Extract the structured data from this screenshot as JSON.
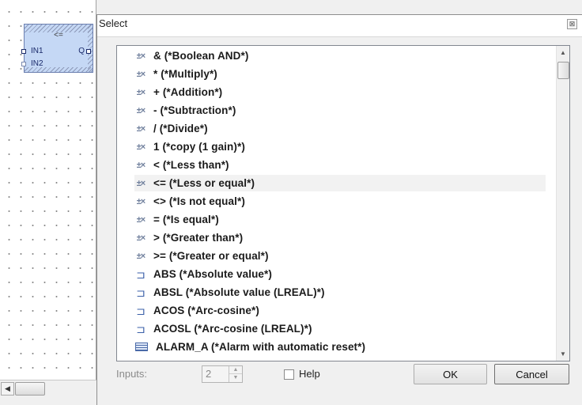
{
  "canvas": {
    "block": {
      "name": "<=",
      "input1": "IN1",
      "input2": "IN2",
      "output": "Q"
    }
  },
  "dialog": {
    "title": "Select",
    "items": [
      {
        "icon": "operator-icon",
        "label": "& (*Boolean AND*)"
      },
      {
        "icon": "operator-icon",
        "label": "* (*Multiply*)"
      },
      {
        "icon": "operator-icon",
        "label": "+ (*Addition*)"
      },
      {
        "icon": "operator-icon",
        "label": "- (*Subtraction*)"
      },
      {
        "icon": "operator-icon",
        "label": "/ (*Divide*)"
      },
      {
        "icon": "operator-icon",
        "label": "1 (*copy (1 gain)*)"
      },
      {
        "icon": "operator-icon",
        "label": "< (*Less than*)"
      },
      {
        "icon": "operator-icon",
        "label": "<= (*Less or equal*)",
        "highlighted": true
      },
      {
        "icon": "operator-icon",
        "label": "<> (*Is not equal*)"
      },
      {
        "icon": "operator-icon",
        "label": "= (*Is equal*)"
      },
      {
        "icon": "operator-icon",
        "label": "> (*Greater than*)"
      },
      {
        "icon": "operator-icon",
        "label": ">= (*Greater or equal*)"
      },
      {
        "icon": "function-icon",
        "label": "ABS (*Absolute value*)"
      },
      {
        "icon": "function-icon",
        "label": "ABSL (*Absolute value (LREAL)*)"
      },
      {
        "icon": "function-icon",
        "label": "ACOS (*Arc-cosine*)"
      },
      {
        "icon": "function-icon",
        "label": "ACOSL (*Arc-cosine (LREAL)*)"
      },
      {
        "icon": "function-block-icon",
        "label": "ALARM_A (*Alarm with automatic reset*)"
      }
    ],
    "inputs_label": "Inputs:",
    "inputs_value": "2",
    "help_label": "Help",
    "help_checked": false,
    "ok_label": "OK",
    "cancel_label": "Cancel"
  }
}
